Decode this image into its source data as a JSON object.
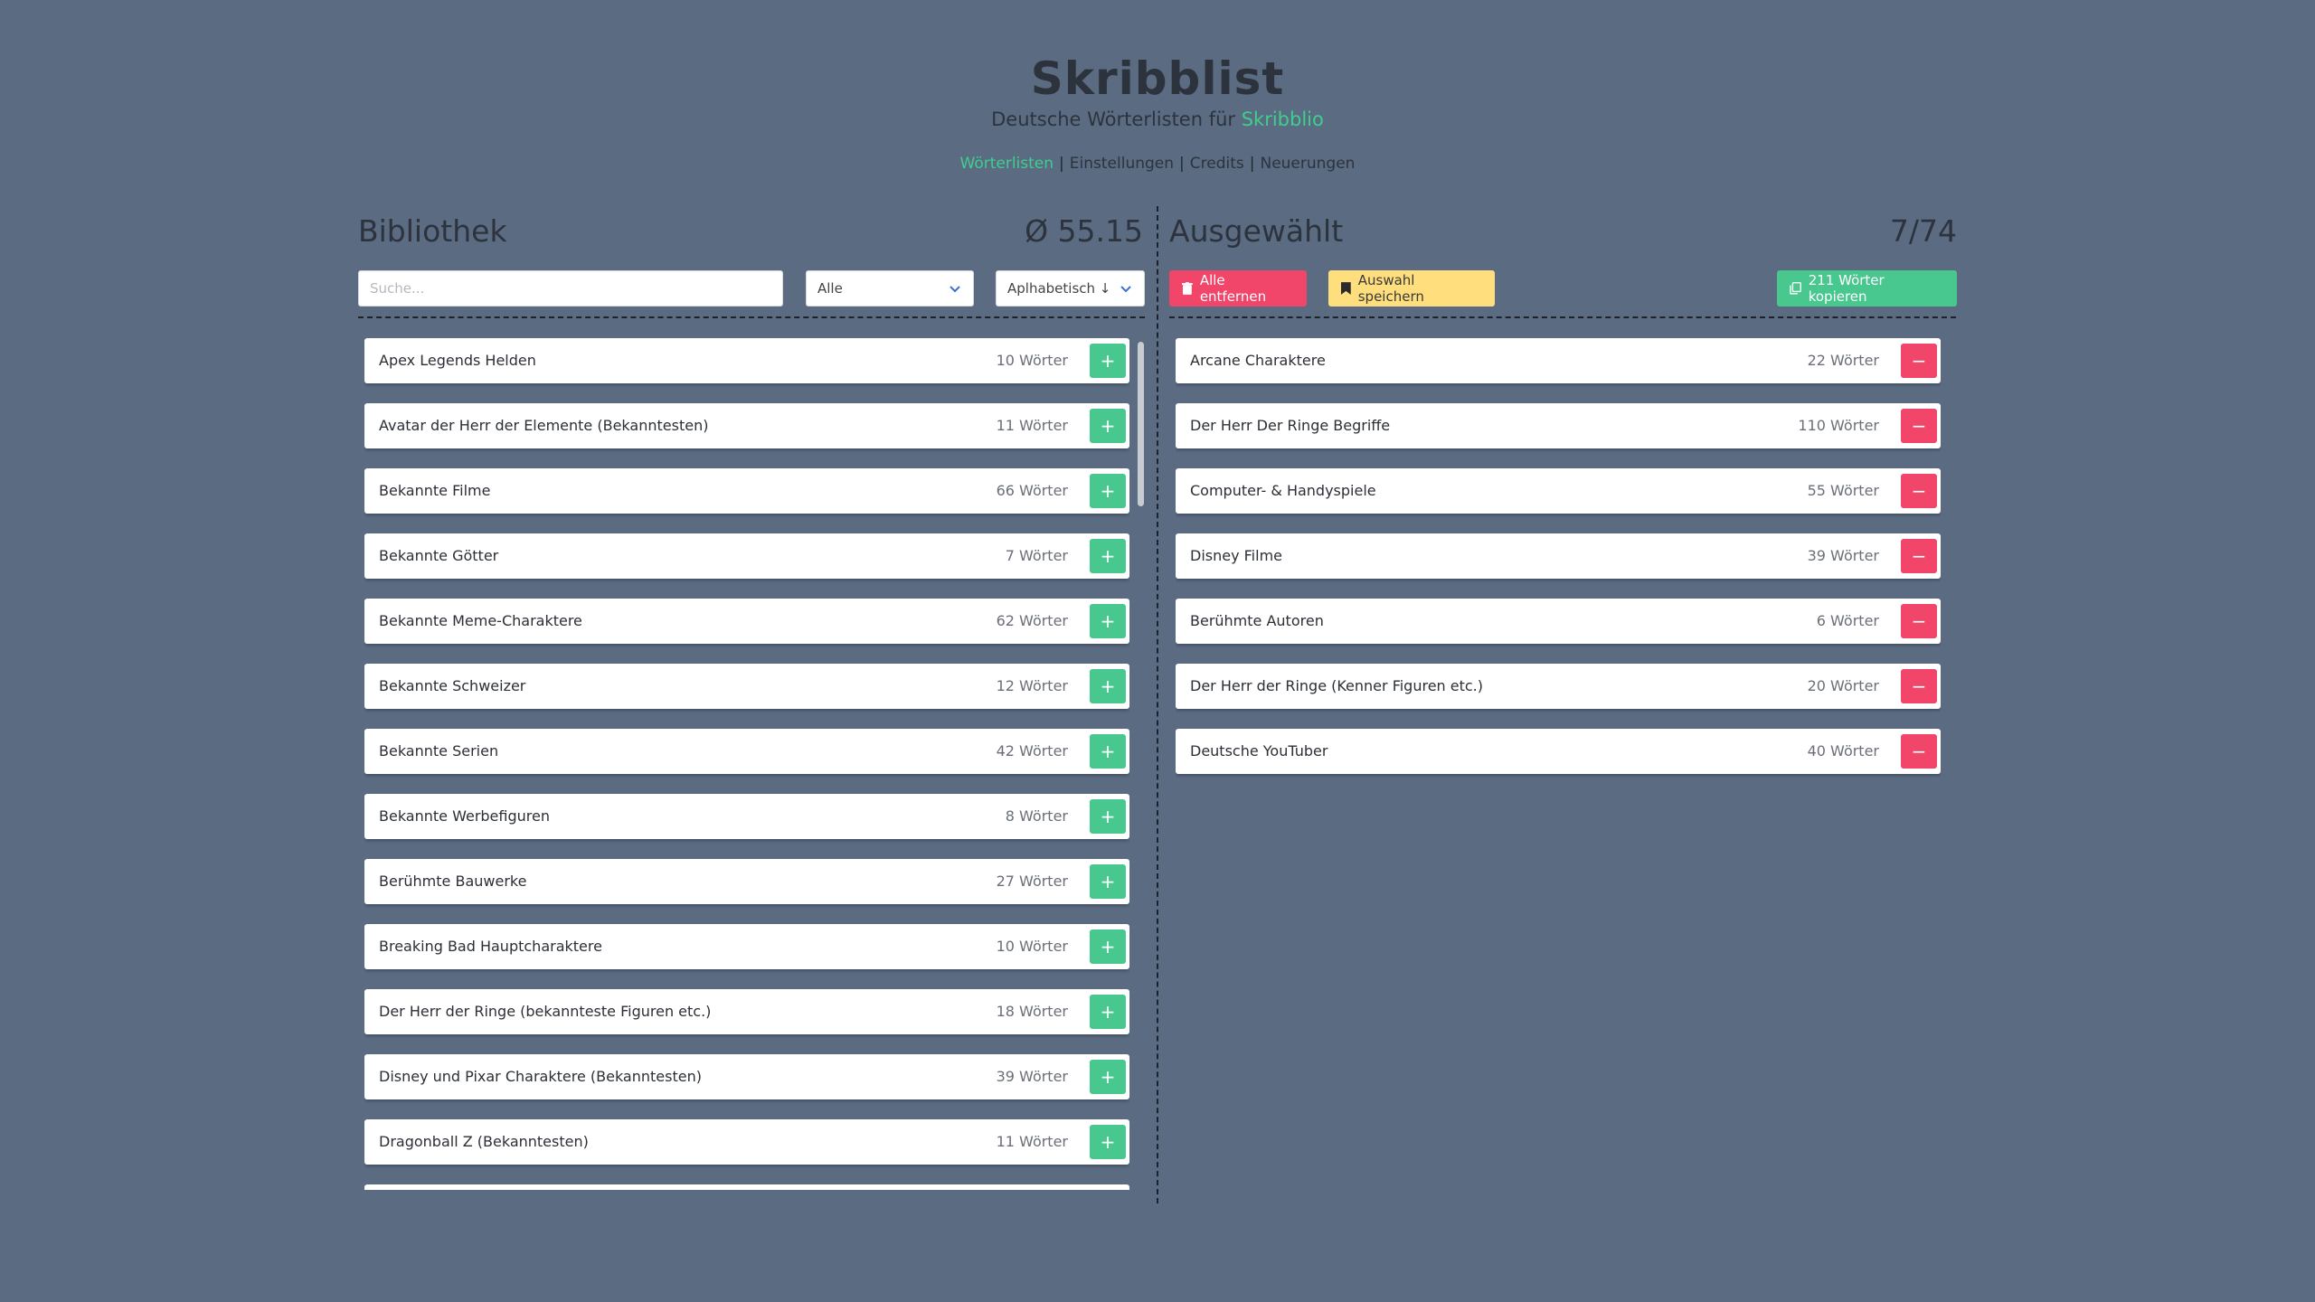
{
  "header": {
    "title": "Skribblist",
    "subtitle_prefix": "Deutsche Wörterlisten für ",
    "subtitle_link": "Skribblio",
    "nav": [
      {
        "label": "Wörterlisten",
        "active": true
      },
      {
        "label": "Einstellungen",
        "active": false
      },
      {
        "label": "Credits",
        "active": false
      },
      {
        "label": "Neuerungen",
        "active": false
      }
    ]
  },
  "library": {
    "title": "Bibliothek",
    "average": "Ø 55.15",
    "search_placeholder": "Suche...",
    "filter_value": "Alle",
    "sort_value": "Aplhabetisch ↓",
    "add_symbol": "+",
    "items": [
      {
        "name": "Apex Legends Helden",
        "count": "10 Wörter"
      },
      {
        "name": "Avatar der Herr der Elemente (Bekanntesten)",
        "count": "11 Wörter"
      },
      {
        "name": "Bekannte Filme",
        "count": "66 Wörter"
      },
      {
        "name": "Bekannte Götter",
        "count": "7 Wörter"
      },
      {
        "name": "Bekannte Meme-Charaktere",
        "count": "62 Wörter"
      },
      {
        "name": "Bekannte Schweizer",
        "count": "12 Wörter"
      },
      {
        "name": "Bekannte Serien",
        "count": "42 Wörter"
      },
      {
        "name": "Bekannte Werbefiguren",
        "count": "8 Wörter"
      },
      {
        "name": "Berühmte Bauwerke",
        "count": "27 Wörter"
      },
      {
        "name": "Breaking Bad Hauptcharaktere",
        "count": "10 Wörter"
      },
      {
        "name": "Der Herr der Ringe (bekannteste Figuren etc.)",
        "count": "18 Wörter"
      },
      {
        "name": "Disney und Pixar Charaktere (Bekanntesten)",
        "count": "39 Wörter"
      },
      {
        "name": "Dragonball Z (Bekanntesten)",
        "count": "11 Wörter"
      },
      {
        "name": "",
        "count": ""
      }
    ]
  },
  "selected": {
    "title": "Ausgewählt",
    "ratio": "7/74",
    "remove_all_label": "Alle entfernen",
    "save_label": "Auswahl speichern",
    "copy_label": "211 Wörter kopieren",
    "remove_symbol": "−",
    "items": [
      {
        "name": "Arcane Charaktere",
        "count": "22 Wörter"
      },
      {
        "name": "Der Herr Der Ringe Begriffe",
        "count": "110 Wörter"
      },
      {
        "name": "Computer- & Handyspiele",
        "count": "55 Wörter"
      },
      {
        "name": "Disney Filme",
        "count": "39 Wörter"
      },
      {
        "name": "Berühmte Autoren",
        "count": "6 Wörter"
      },
      {
        "name": "Der Herr der Ringe (Kenner Figuren etc.)",
        "count": "20 Wörter"
      },
      {
        "name": "Deutsche YouTuber",
        "count": "40 Wörter"
      }
    ]
  },
  "colors": {
    "background": "#5a6b82",
    "accent_green": "#48c78e",
    "danger_red": "#f1456a",
    "warning_yellow": "#ffde7d"
  }
}
